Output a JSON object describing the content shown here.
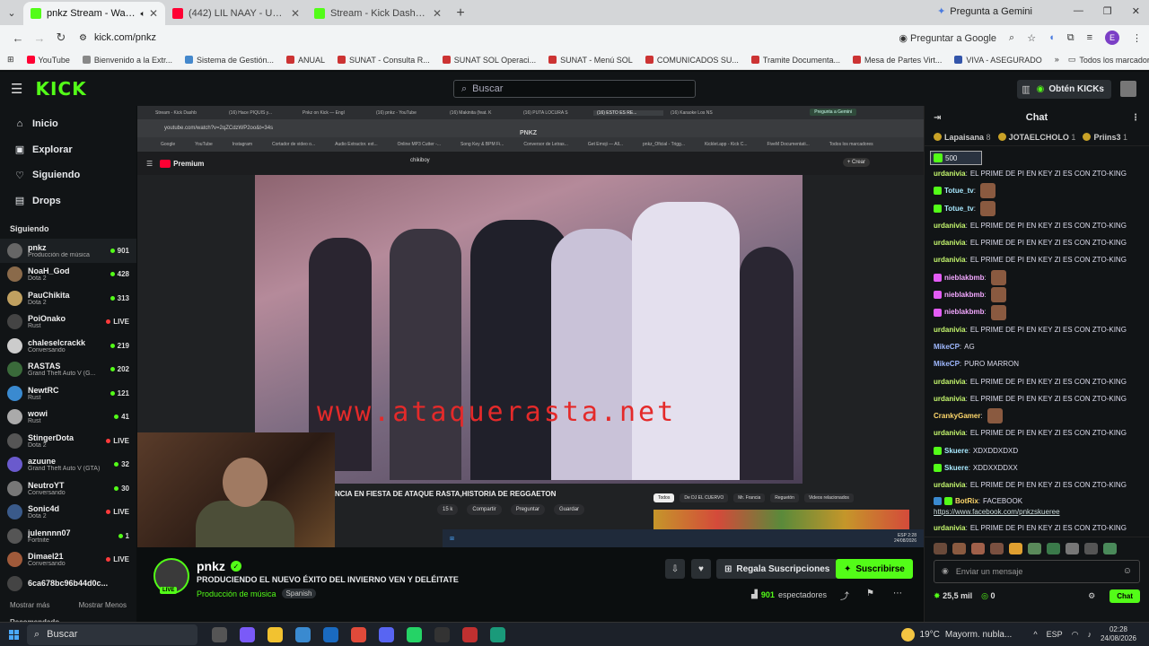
{
  "browser": {
    "tabs": [
      {
        "title": "pnkz Stream - Watch Live o",
        "fav": "#53fc18",
        "active": true
      },
      {
        "title": "(442) LIL NAAY - UNA BABY EN",
        "fav": "#ff0033",
        "active": false
      },
      {
        "title": "Stream - Kick Dashboard",
        "fav": "#53fc18",
        "active": false
      }
    ],
    "gemini": "Pregunta a Gemini",
    "url": "kick.com/pnkz",
    "ask_google": "Preguntar a Google",
    "profile_initial": "E",
    "bookmarks": [
      "YouTube",
      "Bienvenido a la Extr...",
      "Sistema de Gestión...",
      "ANUAL",
      "SUNAT - Consulta R...",
      "SUNAT SOL Operaci...",
      "SUNAT - Menú SOL",
      "COMUNICADOS SU...",
      "Tramite Documenta...",
      "Mesa de Partes Virt...",
      "VIVA - ASEGURADO"
    ],
    "bookmark_colors": [
      "#ff0033",
      "#888",
      "#4488cc",
      "#cc3333",
      "#cc3333",
      "#cc3333",
      "#cc3333",
      "#cc3333",
      "#cc3333",
      "#cc3333",
      "#3355aa"
    ],
    "all_bookmarks": "Todos los marcadores"
  },
  "kick": {
    "logo": "KICK",
    "search_placeholder": "Buscar",
    "obten": "Obtén KICKs"
  },
  "sidebar": {
    "nav": [
      {
        "label": "Inicio",
        "icon": "home-icon"
      },
      {
        "label": "Explorar",
        "icon": "compass-icon"
      },
      {
        "label": "Siguiendo",
        "icon": "heart-icon"
      },
      {
        "label": "Drops",
        "icon": "drops-icon"
      }
    ],
    "following_title": "Siguiendo",
    "following": [
      {
        "name": "pnkz",
        "cat": "Producción de música",
        "count": "901",
        "color": "#666"
      },
      {
        "name": "NoaH_God",
        "cat": "Dota 2",
        "count": "428",
        "color": "#8a6a4a"
      },
      {
        "name": "PauChikita",
        "cat": "Dota 2",
        "count": "313",
        "color": "#c0a060"
      },
      {
        "name": "PoiOnako",
        "cat": "Rust",
        "count": "LIVE",
        "color": "#444"
      },
      {
        "name": "chaleselcrackk",
        "cat": "Conversando",
        "count": "219",
        "color": "#ccc"
      },
      {
        "name": "RASTAS",
        "cat": "Grand Theft Auto V (G...",
        "count": "202",
        "color": "#3a6a3a"
      },
      {
        "name": "NewtRC",
        "cat": "Rust",
        "count": "121",
        "color": "#3a8ad0"
      },
      {
        "name": "wowi",
        "cat": "Rust",
        "count": "41",
        "color": "#aaa"
      },
      {
        "name": "StingerDota",
        "cat": "Dota 2",
        "count": "LIVE",
        "color": "#555"
      },
      {
        "name": "azuune",
        "cat": "Grand Theft Auto V (GTA)",
        "count": "32",
        "color": "#6a5acd"
      },
      {
        "name": "NeutroYT",
        "cat": "Conversando",
        "count": "30",
        "color": "#777"
      },
      {
        "name": "Sonic4d",
        "cat": "Dota 2",
        "count": "LIVE",
        "color": "#3a5a8a"
      },
      {
        "name": "julennnn07",
        "cat": "Fortnite",
        "count": "1",
        "color": "#555"
      },
      {
        "name": "Dimael21",
        "cat": "Conversando",
        "count": "LIVE",
        "color": "#a05a3a"
      },
      {
        "name": "6ca678bc96b44d0c...",
        "cat": "",
        "count": "",
        "color": "#444"
      }
    ],
    "show_more": "Mostrar más",
    "show_less": "Mostrar Menos",
    "recommended": "Recomendado"
  },
  "video": {
    "inner_tabs": [
      "Stream - Kick Dashb",
      "(16) Hace PIQUIS y...",
      "Pnkz on Kick — Engl",
      "(16) pnkz - YouTube",
      "(16) Makinita (feat. K",
      "(16) PUTA LOCURA S",
      "(16) ESTO ES RE...",
      "(16) Karaoke Los NS"
    ],
    "inner_gemini": "Pregunta a Gemini",
    "inner_url": "youtube.com/watch?v=2qZCdzWP2oo&t=34s",
    "inner_logo": "PNKZ",
    "inner_bookmarks": [
      "Google",
      "YouTube",
      "Instagram",
      "Cortador de video o...",
      "Audio Extractor. ext...",
      "Online MP3 Cutter -...",
      "Song Key & BPM Fi...",
      "Conversor de Letras...",
      "Get Emoji — All...",
      "pnkz_Oficial - Trigg...",
      "Kicklet.app - Kick C...",
      "FiveM Documentati..."
    ],
    "all_bm": "Todos los marcadores",
    "yt_logo": "Premium",
    "yt_search": "chikiboy",
    "yt_create": "+ Crear",
    "watermark": "www.ataquerasta.net",
    "caption": "NCIA EN FIESTA DE ATAQUE RASTA,HISTORIA DE REGGAETON",
    "actions": [
      "15 k",
      "",
      "Compartir",
      "Preguntar",
      "Guardar"
    ],
    "chips": [
      "Todos",
      "De DJ EL CUERVO",
      "Mr. Francia",
      "Reguetón",
      "Videos relacionados"
    ],
    "thumb_caption": "Culiouellus Vs Wachiit agarran a los golpes",
    "taskbar_time": "2:28",
    "taskbar_date": "24/08/2026",
    "taskbar_lang": "ESP"
  },
  "stream": {
    "name": "pnkz",
    "title": "PRODUCIENDO EL NUEVO ÉXITO DEL INVIERNO VEN Y DELÉITATE",
    "category": "Producción de música",
    "language": "Spanish",
    "live": "LIVE",
    "gift_button": "Regala Suscripciones",
    "subscribe_button": "Suscribirse",
    "viewers": "901",
    "viewers_label": "espectadores"
  },
  "chat": {
    "title": "Chat",
    "leaders": [
      {
        "name": "Lapaisana",
        "n": "8"
      },
      {
        "name": "JOTAELCHOLO",
        "n": "1"
      },
      {
        "name": "Priins3",
        "n": "1"
      }
    ],
    "gift_amount": "500",
    "messages": [
      {
        "user": "urdanivia",
        "color": "#c6f86e",
        "badge": "",
        "text": "EL PRIME DE PI EN KEY ZI ES CON ZTO-KING",
        "emote": false
      },
      {
        "user": "Totue_tv",
        "color": "#a8e9ff",
        "badge": "#53fc18",
        "text": "",
        "emote": true
      },
      {
        "user": "Totue_tv",
        "color": "#a8e9ff",
        "badge": "#53fc18",
        "text": "",
        "emote": true
      },
      {
        "user": "urdanivia",
        "color": "#c6f86e",
        "badge": "",
        "text": "EL PRIME DE PI EN KEY ZI ES CON ZTO-KING",
        "emote": false
      },
      {
        "user": "urdanivia",
        "color": "#c6f86e",
        "badge": "",
        "text": "EL PRIME DE PI EN KEY ZI ES CON ZTO-KING",
        "emote": false
      },
      {
        "user": "urdanivia",
        "color": "#c6f86e",
        "badge": "",
        "text": "EL PRIME DE PI EN KEY ZI ES CON ZTO-KING",
        "emote": false
      },
      {
        "user": "nieblakbmb",
        "color": "#f3a8ff",
        "badge": "#e35cf5",
        "text": "",
        "emote": true
      },
      {
        "user": "nieblakbmb",
        "color": "#f3a8ff",
        "badge": "#e35cf5",
        "text": "",
        "emote": true
      },
      {
        "user": "nieblakbmb",
        "color": "#f3a8ff",
        "badge": "#e35cf5",
        "text": "",
        "emote": true
      },
      {
        "user": "urdanivia",
        "color": "#c6f86e",
        "badge": "",
        "text": "EL PRIME DE PI EN KEY ZI ES CON ZTO-KING",
        "emote": false
      },
      {
        "user": "MikeCP",
        "color": "#9fb8ff",
        "badge": "",
        "text": "AG",
        "emote": false
      },
      {
        "user": "MikeCP",
        "color": "#9fb8ff",
        "badge": "",
        "text": "PURO MARRON",
        "emote": false
      },
      {
        "user": "urdanivia",
        "color": "#c6f86e",
        "badge": "",
        "text": "EL PRIME DE PI EN KEY ZI ES CON ZTO-KING",
        "emote": false
      },
      {
        "user": "urdanivia",
        "color": "#c6f86e",
        "badge": "",
        "text": "EL PRIME DE PI EN KEY ZI ES CON ZTO-KING",
        "emote": false
      },
      {
        "user": "CrankyGamer",
        "color": "#ffd86b",
        "badge": "",
        "text": "",
        "emote": true
      },
      {
        "user": "urdanivia",
        "color": "#c6f86e",
        "badge": "",
        "text": "EL PRIME DE PI EN KEY ZI ES CON ZTO-KING",
        "emote": false
      },
      {
        "user": "Skuere",
        "color": "#a8e9ff",
        "badge": "#53fc18",
        "text": "XDXDDXDXD",
        "emote": false
      },
      {
        "user": "Skuere",
        "color": "#a8e9ff",
        "badge": "#53fc18",
        "text": "XDDXXDDXX",
        "emote": false
      },
      {
        "user": "urdanivia",
        "color": "#c6f86e",
        "badge": "",
        "text": "EL PRIME DE PI EN KEY ZI ES CON ZTO-KING",
        "emote": false
      }
    ],
    "bot_user": "BotRix",
    "bot_text": "FACEBOOK",
    "bot_link": "https://www.facebook.com/pnkzskueree",
    "last_message": {
      "user": "urdanivia",
      "text": "EL PRIME DE PI EN KEY ZI ES CON ZTO-KING"
    },
    "input_placeholder": "Enviar un mensaje",
    "kicks": "25,5 mil",
    "points": "0",
    "chat_button": "Chat"
  },
  "taskbar": {
    "search": "Buscar",
    "temp": "19°C",
    "weather": "Mayorm. nubla...",
    "lang": "ESP",
    "time": "02:28",
    "date": "24/08/2026"
  }
}
